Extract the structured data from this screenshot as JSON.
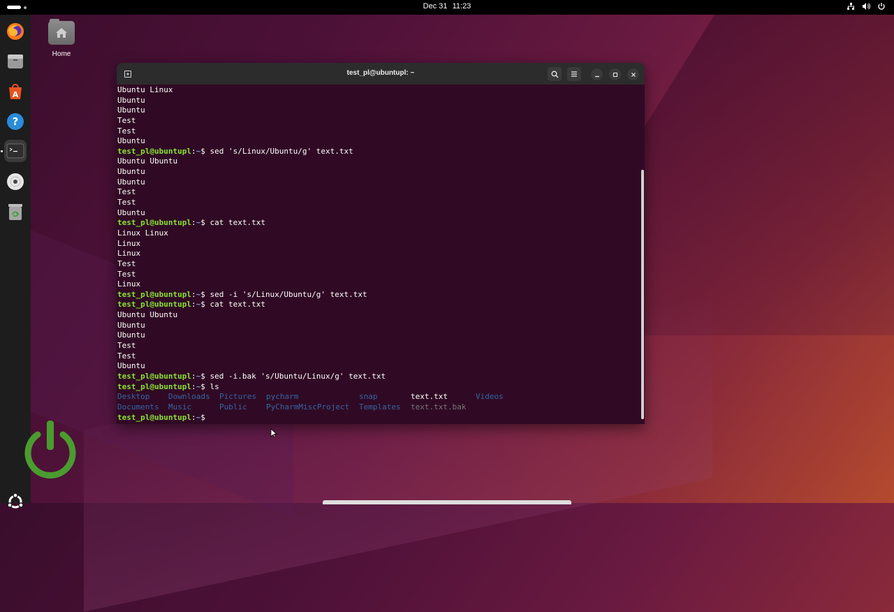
{
  "topbar": {
    "date": "Dec 31",
    "time": "11:23"
  },
  "dock": {
    "items": [
      {
        "name": "firefox-icon"
      },
      {
        "name": "files-icon"
      },
      {
        "name": "app-center-icon"
      },
      {
        "name": "help-icon"
      },
      {
        "name": "terminal-icon",
        "active": true
      },
      {
        "name": "disc-icon"
      },
      {
        "name": "trash-icon"
      }
    ]
  },
  "desktop": {
    "home_label": "Home"
  },
  "terminal": {
    "title": "test_pl@ubuntupl: ~",
    "prompt_user": "test_pl@ubuntupl",
    "prompt_sep": ":",
    "prompt_path": "~",
    "prompt_symbol": "$",
    "lines": [
      {
        "type": "out",
        "text": "Ubuntu Linux"
      },
      {
        "type": "out",
        "text": "Ubuntu"
      },
      {
        "type": "out",
        "text": "Ubuntu"
      },
      {
        "type": "out",
        "text": "Test"
      },
      {
        "type": "out",
        "text": "Test"
      },
      {
        "type": "out",
        "text": "Ubuntu"
      },
      {
        "type": "cmd",
        "text": "sed 's/Linux/Ubuntu/g' text.txt"
      },
      {
        "type": "out",
        "text": "Ubuntu Ubuntu"
      },
      {
        "type": "out",
        "text": "Ubuntu"
      },
      {
        "type": "out",
        "text": "Ubuntu"
      },
      {
        "type": "out",
        "text": "Test"
      },
      {
        "type": "out",
        "text": "Test"
      },
      {
        "type": "out",
        "text": "Ubuntu"
      },
      {
        "type": "cmd",
        "text": "cat text.txt"
      },
      {
        "type": "out",
        "text": "Linux Linux"
      },
      {
        "type": "out",
        "text": "Linux"
      },
      {
        "type": "out",
        "text": "Linux"
      },
      {
        "type": "out",
        "text": "Test"
      },
      {
        "type": "out",
        "text": "Test"
      },
      {
        "type": "out",
        "text": "Linux"
      },
      {
        "type": "cmd",
        "text": "sed -i 's/Linux/Ubuntu/g' text.txt"
      },
      {
        "type": "cmd",
        "text": "cat text.txt"
      },
      {
        "type": "out",
        "text": "Ubuntu Ubuntu"
      },
      {
        "type": "out",
        "text": "Ubuntu"
      },
      {
        "type": "out",
        "text": "Ubuntu"
      },
      {
        "type": "out",
        "text": "Test"
      },
      {
        "type": "out",
        "text": "Test"
      },
      {
        "type": "out",
        "text": "Ubuntu"
      },
      {
        "type": "cmd",
        "text": "sed -i.bak 's/Ubuntu/Linux/g' text.txt"
      },
      {
        "type": "cmd",
        "text": "ls"
      }
    ],
    "ls_output": [
      [
        {
          "text": "Desktop",
          "kind": "dir"
        },
        {
          "text": "Downloads",
          "kind": "dir"
        },
        {
          "text": "Pictures",
          "kind": "dir"
        },
        {
          "text": "pycharm",
          "kind": "dir"
        },
        {
          "text": "snap",
          "kind": "dir"
        },
        {
          "text": "text.txt",
          "kind": "file"
        },
        {
          "text": "Videos",
          "kind": "dir"
        }
      ],
      [
        {
          "text": "Documents",
          "kind": "dir"
        },
        {
          "text": "Music",
          "kind": "dir"
        },
        {
          "text": "Public",
          "kind": "dir"
        },
        {
          "text": "PyCharmMiscProject",
          "kind": "dir"
        },
        {
          "text": "Templates",
          "kind": "dir"
        },
        {
          "text": "text.txt.bak",
          "kind": "bak"
        }
      ]
    ],
    "colors": {
      "background": "#300a24",
      "prompt_user": "#8ae234",
      "prompt_path": "#729fcf",
      "directory": "#3465a4",
      "backup_file": "#777777"
    }
  }
}
